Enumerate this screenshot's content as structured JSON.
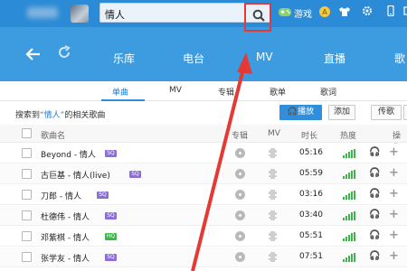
{
  "header": {
    "search_value": "情人",
    "games_label": "游戏"
  },
  "nav": {
    "tabs": [
      "乐库",
      "电台",
      "MV",
      "直播",
      "歌"
    ]
  },
  "subtabs": [
    "单曲",
    "MV",
    "专辑",
    "歌单",
    "歌词"
  ],
  "result": {
    "prefix": "搜索到",
    "keyword": "“情人”",
    "suffix": "的相关歌曲",
    "play_label": "播放",
    "add_label": "添加",
    "upload_label": "传歌"
  },
  "table": {
    "headers": {
      "name": "歌曲名",
      "album": "专辑",
      "mv": "MV",
      "duration": "时长",
      "heat": "热度",
      "action": "操作"
    },
    "rows": [
      {
        "title": "Beyond - 情人",
        "tag": "SQ",
        "duration": "05:16"
      },
      {
        "title": "古巨基 - 情人(live)",
        "tag": "SQ",
        "duration": "05:59"
      },
      {
        "title": "刀郎 - 情人",
        "tag": "SQ",
        "duration": "03:16"
      },
      {
        "title": "杜德伟 - 情人",
        "tag": "SQ",
        "duration": "03:40"
      },
      {
        "title": "邓紫棋 - 情人",
        "tag": "HQ",
        "duration": "05:51"
      },
      {
        "title": "张学友 - 情人",
        "tag": "SQ",
        "duration": "07:51"
      }
    ]
  },
  "colors": {
    "header_bg": "#2c8bd6",
    "nav_bg": "#3d9be0",
    "accent": "#2f8fdd",
    "highlight_box": "#e53935",
    "sq_tag": "#8c6fd6",
    "hq_tag": "#3cb54a"
  }
}
